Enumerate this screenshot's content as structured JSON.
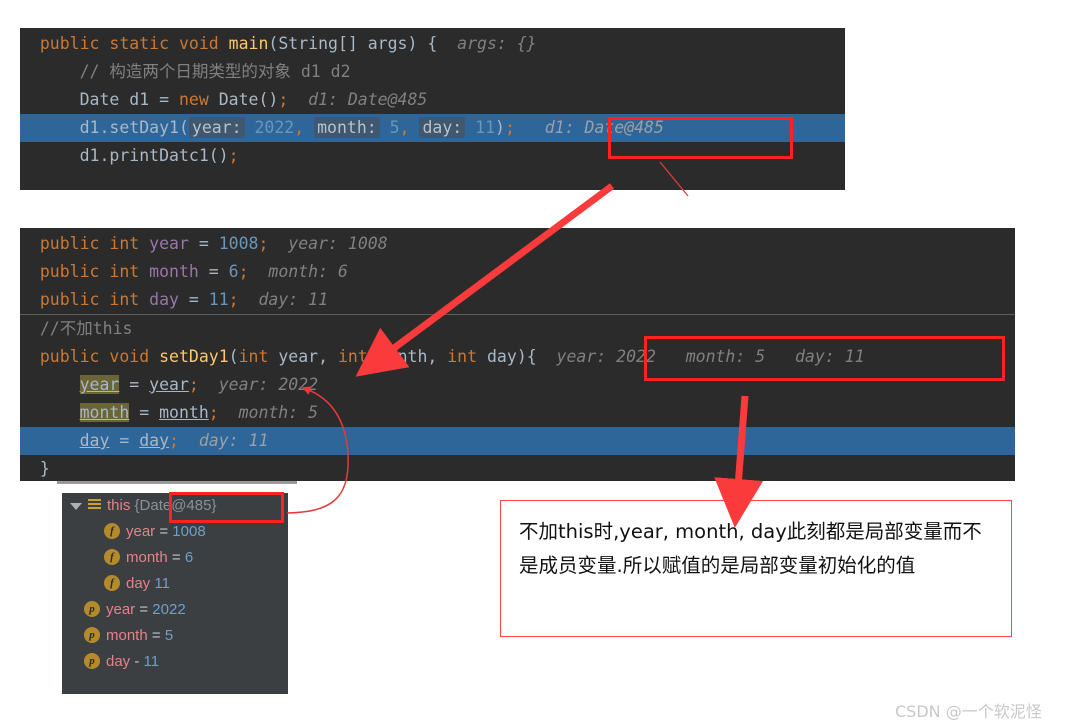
{
  "editor_main": {
    "name": "main-method-code-block",
    "lines": [
      {
        "id": "l1",
        "indent": 0,
        "highlight": false,
        "tokens": [
          {
            "t": "public ",
            "c": "kw"
          },
          {
            "t": "static ",
            "c": "kw"
          },
          {
            "t": "void ",
            "c": "kw"
          },
          {
            "t": "main",
            "c": "fn"
          },
          {
            "t": "(",
            "c": "punc"
          },
          {
            "t": "String",
            "c": "typ"
          },
          {
            "t": "[] args) {",
            "c": "punc"
          },
          {
            "t": "  args: {}",
            "c": "hint"
          }
        ]
      },
      {
        "id": "l2",
        "indent": 1,
        "highlight": false,
        "tokens": [
          {
            "t": "// 构造两个日期类型的对象 d1 d2",
            "c": "cmt"
          }
        ]
      },
      {
        "id": "l3",
        "indent": 1,
        "highlight": false,
        "tokens": [
          {
            "t": "Date ",
            "c": "typ"
          },
          {
            "t": "d1 = ",
            "c": "punc"
          },
          {
            "t": "new ",
            "c": "kw"
          },
          {
            "t": "Date",
            "c": "typ"
          },
          {
            "t": "()",
            "c": "punc"
          },
          {
            "t": ";",
            "c": "semi"
          },
          {
            "t": "  d1: Date@485",
            "c": "hint"
          }
        ]
      },
      {
        "id": "l4",
        "indent": 1,
        "highlight": true,
        "tokens": [
          {
            "t": "d1.setDay1(",
            "c": "punc"
          },
          {
            "t": "year:",
            "c": "chip"
          },
          {
            "t": " ",
            "c": "punc"
          },
          {
            "t": "2022",
            "c": "num"
          },
          {
            "t": ",",
            "c": "semi"
          },
          {
            "t": " ",
            "c": "punc"
          },
          {
            "t": "month:",
            "c": "chip"
          },
          {
            "t": " ",
            "c": "punc"
          },
          {
            "t": "5",
            "c": "num"
          },
          {
            "t": ",",
            "c": "semi"
          },
          {
            "t": " ",
            "c": "punc"
          },
          {
            "t": "day:",
            "c": "chip"
          },
          {
            "t": " ",
            "c": "punc"
          },
          {
            "t": "11",
            "c": "num"
          },
          {
            "t": ")",
            "c": "punc"
          },
          {
            "t": ";",
            "c": "semi"
          },
          {
            "t": "   d1: Date@485",
            "c": "hint-b"
          }
        ]
      },
      {
        "id": "l5",
        "indent": 1,
        "highlight": false,
        "tokens": [
          {
            "t": "d1.printDatc1()",
            "c": "punc"
          },
          {
            "t": ";",
            "c": "semi"
          }
        ]
      }
    ]
  },
  "editor_class": {
    "name": "setday1-method-code-block",
    "lines": [
      {
        "id": "c1",
        "indent": 0,
        "highlight": false,
        "separator_after": false,
        "tokens": [
          {
            "t": "public ",
            "c": "kw"
          },
          {
            "t": "int ",
            "c": "kw"
          },
          {
            "t": "year",
            "c": "fieldv"
          },
          {
            "t": " = ",
            "c": "punc"
          },
          {
            "t": "1008",
            "c": "num"
          },
          {
            "t": ";",
            "c": "semi"
          },
          {
            "t": "  year: 1008",
            "c": "hint"
          }
        ]
      },
      {
        "id": "c2",
        "indent": 0,
        "highlight": false,
        "separator_after": false,
        "tokens": [
          {
            "t": "public ",
            "c": "kw"
          },
          {
            "t": "int ",
            "c": "kw"
          },
          {
            "t": "month",
            "c": "fieldv"
          },
          {
            "t": " = ",
            "c": "punc"
          },
          {
            "t": "6",
            "c": "num"
          },
          {
            "t": ";",
            "c": "semi"
          },
          {
            "t": "  month: 6",
            "c": "hint"
          }
        ]
      },
      {
        "id": "c3",
        "indent": 0,
        "highlight": false,
        "separator_after": true,
        "tokens": [
          {
            "t": "public ",
            "c": "kw"
          },
          {
            "t": "int ",
            "c": "kw"
          },
          {
            "t": "day",
            "c": "fieldv"
          },
          {
            "t": " = ",
            "c": "punc"
          },
          {
            "t": "11",
            "c": "num"
          },
          {
            "t": ";",
            "c": "semi"
          },
          {
            "t": "  day: 11",
            "c": "hint"
          }
        ]
      },
      {
        "id": "c4",
        "indent": 0,
        "highlight": false,
        "separator_after": false,
        "tokens": [
          {
            "t": "//不加this",
            "c": "cmt"
          }
        ]
      },
      {
        "id": "c5",
        "indent": 0,
        "highlight": false,
        "separator_after": false,
        "tokens": [
          {
            "t": "public ",
            "c": "kw"
          },
          {
            "t": "void ",
            "c": "kw"
          },
          {
            "t": "setDay1",
            "c": "fn"
          },
          {
            "t": "(",
            "c": "punc"
          },
          {
            "t": "int ",
            "c": "kw"
          },
          {
            "t": "year",
            "c": "punc"
          },
          {
            "t": ", ",
            "c": "punc"
          },
          {
            "t": "int ",
            "c": "kw"
          },
          {
            "t": "month",
            "c": "punc"
          },
          {
            "t": ", ",
            "c": "punc"
          },
          {
            "t": "int ",
            "c": "kw"
          },
          {
            "t": "day",
            "c": "punc"
          },
          {
            "t": "){",
            "c": "punc"
          },
          {
            "t": "  year: 2022   month: 5   day: 11",
            "c": "hint"
          }
        ]
      },
      {
        "id": "c6",
        "indent": 1,
        "highlight": false,
        "separator_after": false,
        "tokens": [
          {
            "t": "year",
            "c": "write"
          },
          {
            "t": " = ",
            "c": "punc"
          },
          {
            "t": "year",
            "c": "underl"
          },
          {
            "t": ";",
            "c": "semi"
          },
          {
            "t": "  year: 2022",
            "c": "hint"
          }
        ]
      },
      {
        "id": "c7",
        "indent": 1,
        "highlight": false,
        "separator_after": false,
        "tokens": [
          {
            "t": "month",
            "c": "write"
          },
          {
            "t": " = ",
            "c": "punc"
          },
          {
            "t": "month",
            "c": "underl"
          },
          {
            "t": ";",
            "c": "semi"
          },
          {
            "t": "  month: 5",
            "c": "hint"
          }
        ]
      },
      {
        "id": "c8",
        "indent": 1,
        "highlight": true,
        "separator_after": false,
        "tokens": [
          {
            "t": "day",
            "c": "underl"
          },
          {
            "t": " = ",
            "c": "punc"
          },
          {
            "t": "day",
            "c": "underl"
          },
          {
            "t": ";",
            "c": "semi"
          },
          {
            "t": "  day: 11",
            "c": "hint-b"
          }
        ]
      },
      {
        "id": "c9",
        "indent": 0,
        "highlight": false,
        "separator_after": false,
        "tokens": [
          {
            "t": "}",
            "c": "punc"
          }
        ]
      }
    ]
  },
  "debugger": {
    "name": "variables-panel",
    "rows": [
      {
        "icon": "stack-frame-icon",
        "icon_letter": "",
        "expander": "▼",
        "label": "this",
        "sep": "",
        "value": "{Date@485}",
        "value_kind": "obj",
        "level": 0
      },
      {
        "icon": "field-icon",
        "icon_letter": "f",
        "expander": "",
        "label": "year",
        "sep": "=",
        "value": "1008",
        "value_kind": "num",
        "level": 2
      },
      {
        "icon": "field-icon",
        "icon_letter": "f",
        "expander": "",
        "label": "month",
        "sep": "=",
        "value": "6",
        "value_kind": "num",
        "level": 2
      },
      {
        "icon": "field-icon",
        "icon_letter": "f",
        "expander": "",
        "label": "day",
        "sep": "",
        "value": "11",
        "value_kind": "num",
        "level": 2
      },
      {
        "icon": "parameter-icon",
        "icon_letter": "p",
        "expander": "",
        "label": "year",
        "sep": "=",
        "value": "2022",
        "value_kind": "num",
        "level": 1
      },
      {
        "icon": "parameter-icon",
        "icon_letter": "p",
        "expander": "",
        "label": "month",
        "sep": "=",
        "value": "5",
        "value_kind": "num",
        "level": 1
      },
      {
        "icon": "parameter-icon",
        "icon_letter": "p",
        "expander": "",
        "label": "day",
        "sep": "-",
        "value": "11",
        "value_kind": "num",
        "level": 1
      }
    ]
  },
  "note": {
    "name": "explanation-note",
    "text": "不加this时,year, month, day此刻都是局部变量而不是成员变量.所以赋值的是局部变量初始化的值"
  },
  "watermark": {
    "text": "CSDN @一个软泥怪"
  },
  "colors": {
    "editor_bg": "#2b2b2b",
    "panel_bg": "#3c3f41",
    "highlight_line": "#2f6699",
    "annotation_red": "#ff2222",
    "note_border": "#ff4444",
    "keyword": "#cc7832",
    "method": "#ffc66d",
    "number": "#6897bb",
    "field": "#9876aa",
    "hint": "#808080",
    "write_highlight": "#6b6535",
    "debug_name": "#e8808a",
    "debug_icon": "#b58a2b"
  },
  "annotations": {
    "box_main_hint": {
      "label": "red-box-around-d1-hint"
    },
    "box_method_hint": {
      "label": "red-box-around-param-hints"
    },
    "box_this_value": {
      "label": "red-box-around-this-value"
    },
    "arrow_diagonal": {
      "label": "arrow-from-main-hint-to-method-signature"
    },
    "arrow_vertical": {
      "label": "arrow-from-param-hints-to-note"
    },
    "arrow_curve": {
      "label": "curve-from-this-value-to-year-assignment"
    }
  }
}
